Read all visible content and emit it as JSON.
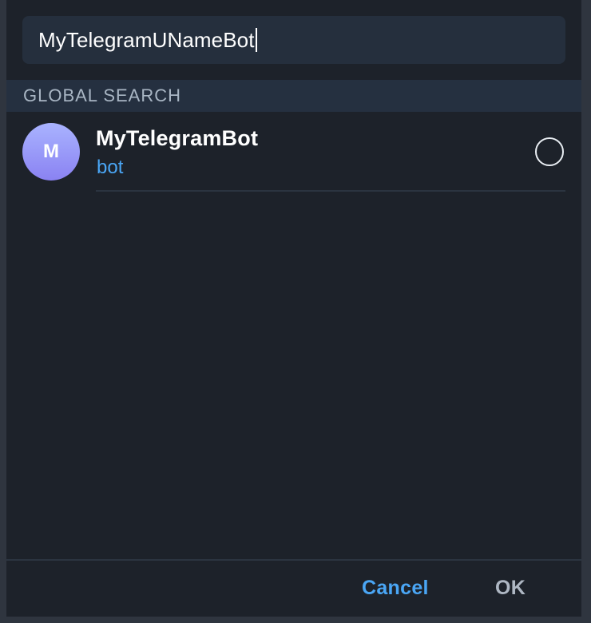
{
  "search": {
    "value": "MyTelegramUNameBot"
  },
  "section": {
    "title": "GLOBAL SEARCH"
  },
  "results": [
    {
      "avatar_letter": "M",
      "name": "MyTelegramBot",
      "subtitle": "bot",
      "selected": false
    }
  ],
  "footer": {
    "cancel_label": "Cancel",
    "ok_label": "OK"
  },
  "colors": {
    "accent": "#4aa6f5",
    "background": "#1d222a",
    "header_bg": "#253040"
  }
}
